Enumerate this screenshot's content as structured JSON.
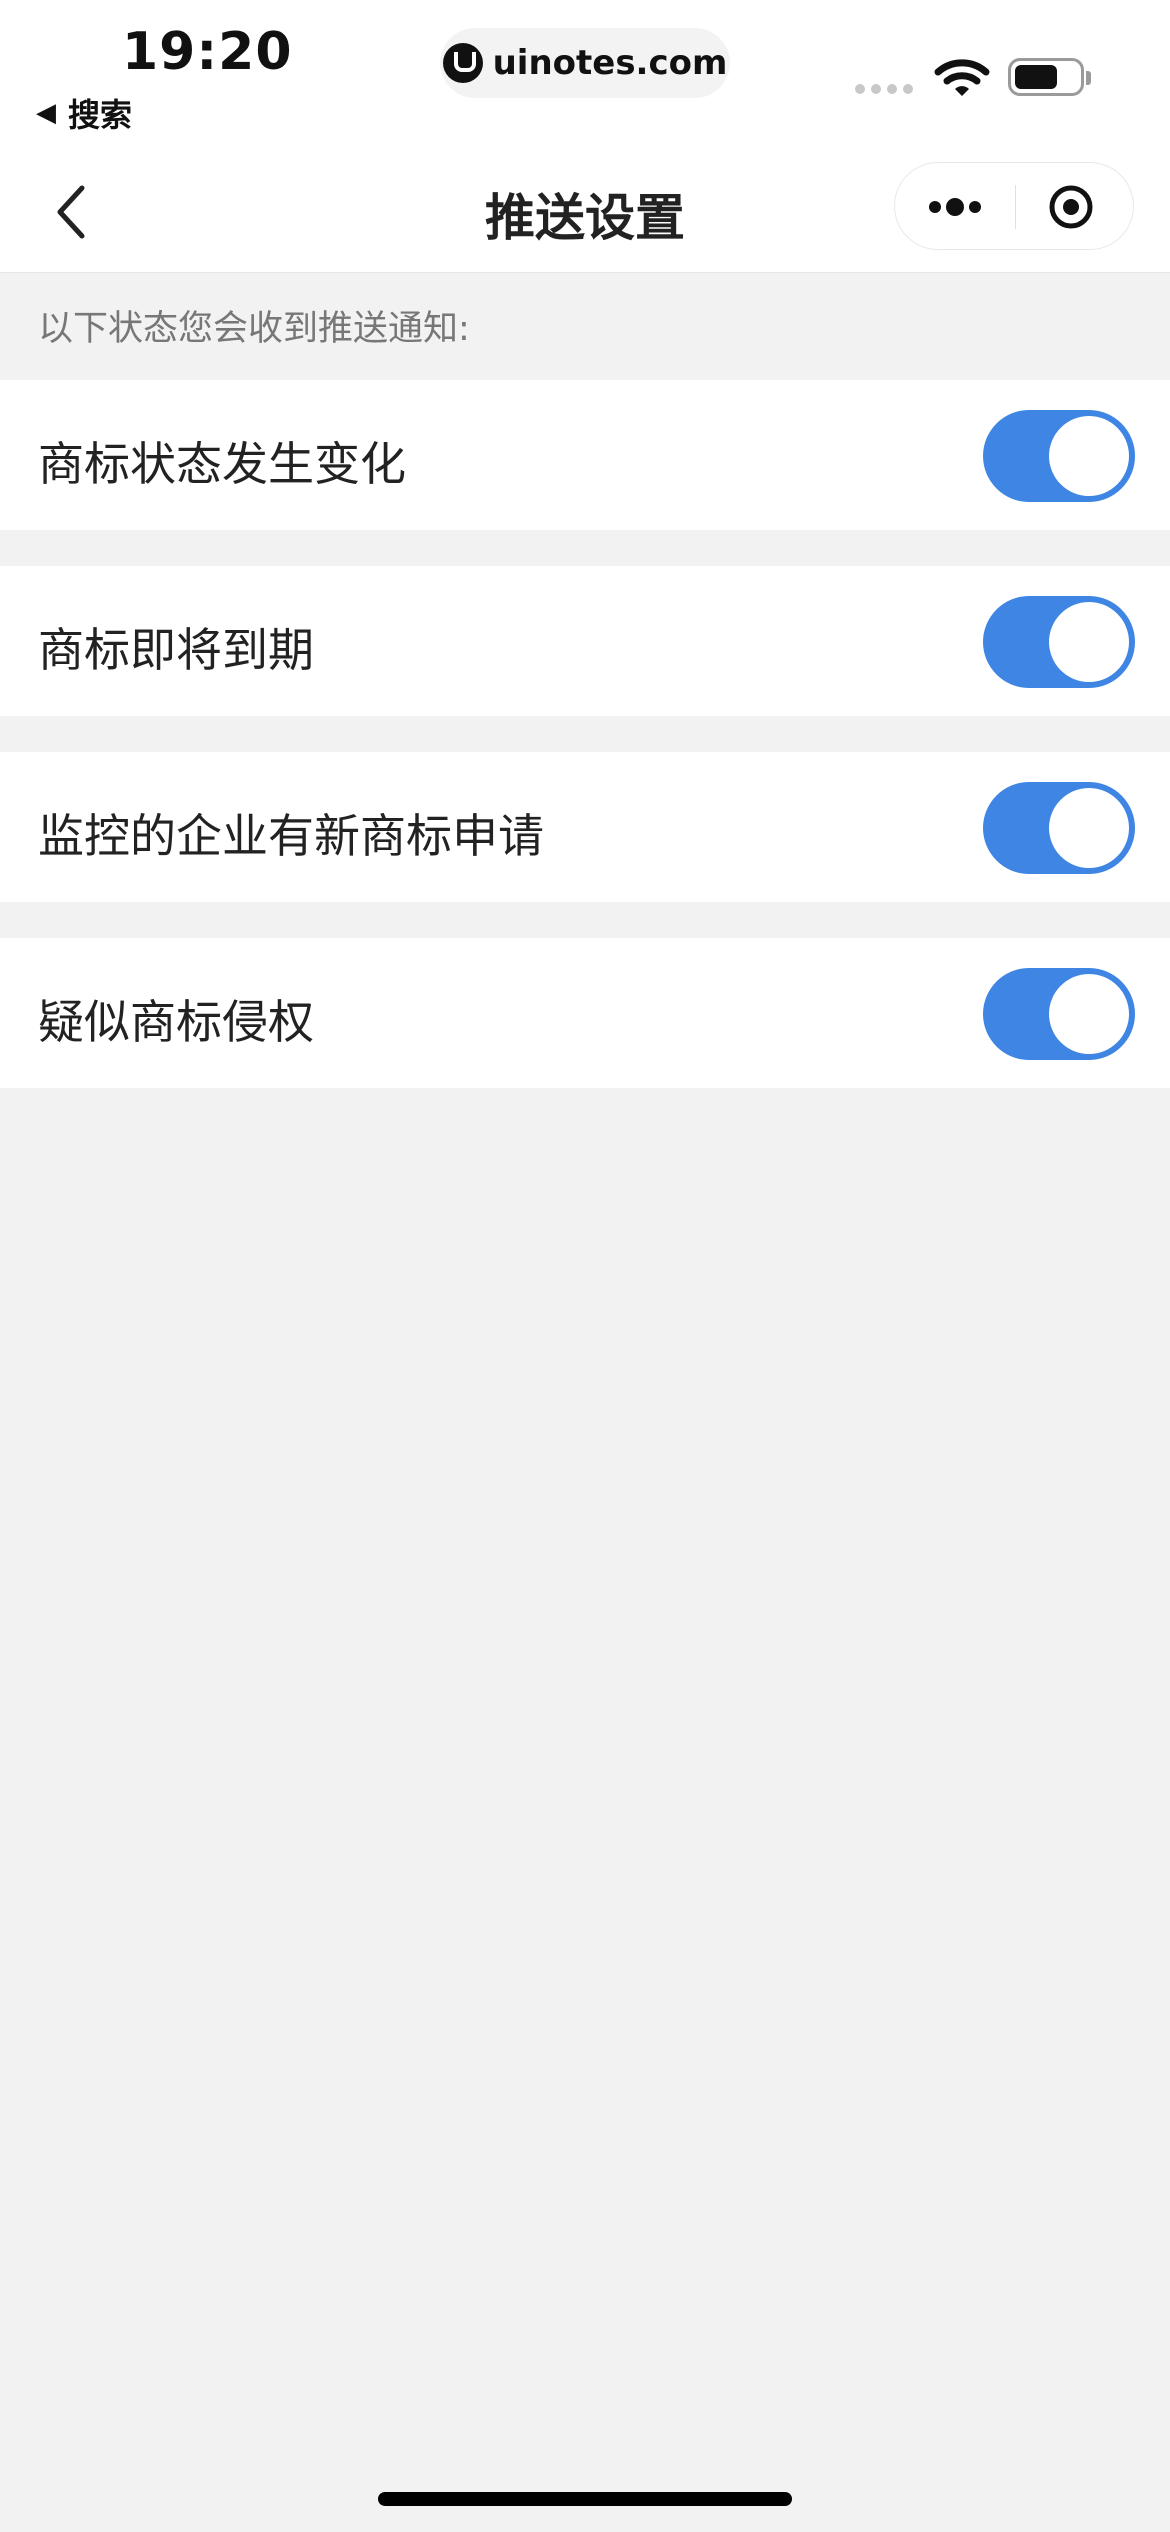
{
  "status_bar": {
    "time": "19:20",
    "back_app_arrow": "◀",
    "back_app_label": "搜索",
    "url": "uinotes.com"
  },
  "nav": {
    "title": "推送设置",
    "back_icon": "chevron-left-icon",
    "more_icon": "more-dots-icon",
    "close_icon": "target-icon"
  },
  "content": {
    "hint": "以下状态您会收到推送通知:",
    "rows": [
      {
        "label": "商标状态发生变化",
        "enabled": true
      },
      {
        "label": "商标即将到期",
        "enabled": true
      },
      {
        "label": "监控的企业有新商标申请",
        "enabled": true
      },
      {
        "label": "疑似商标侵权",
        "enabled": true
      }
    ]
  },
  "colors": {
    "toggle_on": "#3f85e3",
    "background": "#f2f2f2"
  }
}
